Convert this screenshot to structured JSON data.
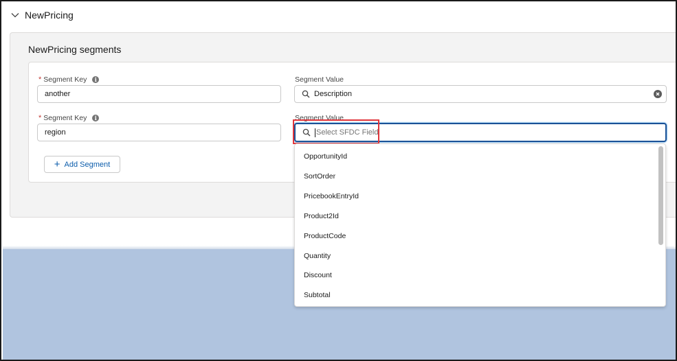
{
  "section": {
    "title": "NewPricing",
    "chevron_icon": "chevron-down-icon"
  },
  "card": {
    "title": "NewPricing segments"
  },
  "segments": [
    {
      "key_label": "Segment Key",
      "key_value": "another",
      "value_label": "Segment Value",
      "value_value": "Description"
    },
    {
      "key_label": "Segment Key",
      "key_value": "region",
      "value_label": "Segment Value",
      "value_placeholder": "Select SFDC Field"
    }
  ],
  "required_marker": "*",
  "info_glyph": "i",
  "add_button": {
    "label": "Add Segment",
    "icon": "+"
  },
  "dropdown": {
    "options": [
      "OpportunityId",
      "SortOrder",
      "PricebookEntryId",
      "Product2Id",
      "ProductCode",
      "Quantity",
      "Discount",
      "Subtotal"
    ]
  },
  "colors": {
    "accent": "#0176d3",
    "focus_border": "#1b5297",
    "highlight": "#e0353b",
    "required": "#c23934",
    "background_blue": "#b0c4df"
  }
}
